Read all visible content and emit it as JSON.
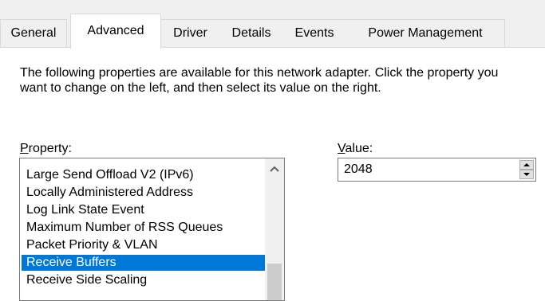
{
  "tabs": [
    {
      "label": "General"
    },
    {
      "label": "Advanced"
    },
    {
      "label": "Driver"
    },
    {
      "label": "Details"
    },
    {
      "label": "Events"
    },
    {
      "label": "Power Management"
    }
  ],
  "active_tab": "Advanced",
  "description": "The following properties are available for this network adapter. Click the property you want to change on the left, and then select its value on the right.",
  "property_label": {
    "mnemonic": "P",
    "rest": "roperty:"
  },
  "value_label": {
    "mnemonic": "V",
    "rest": "alue:"
  },
  "properties": [
    {
      "label": "Large Send Offload V2 (IPv6)"
    },
    {
      "label": "Locally Administered Address"
    },
    {
      "label": "Log Link State Event"
    },
    {
      "label": "Maximum Number of RSS Queues"
    },
    {
      "label": "Packet Priority & VLAN"
    },
    {
      "label": "Receive Buffers"
    },
    {
      "label": "Receive Side Scaling"
    }
  ],
  "selected_property": "Receive Buffers",
  "value": "2048",
  "icons": {
    "scroll_up": "chevron-up-icon",
    "spin_up": "triangle-up-icon",
    "spin_down": "triangle-down-icon"
  },
  "colors": {
    "selection": "#0078d7",
    "window_bg": "#f0f0f0"
  }
}
